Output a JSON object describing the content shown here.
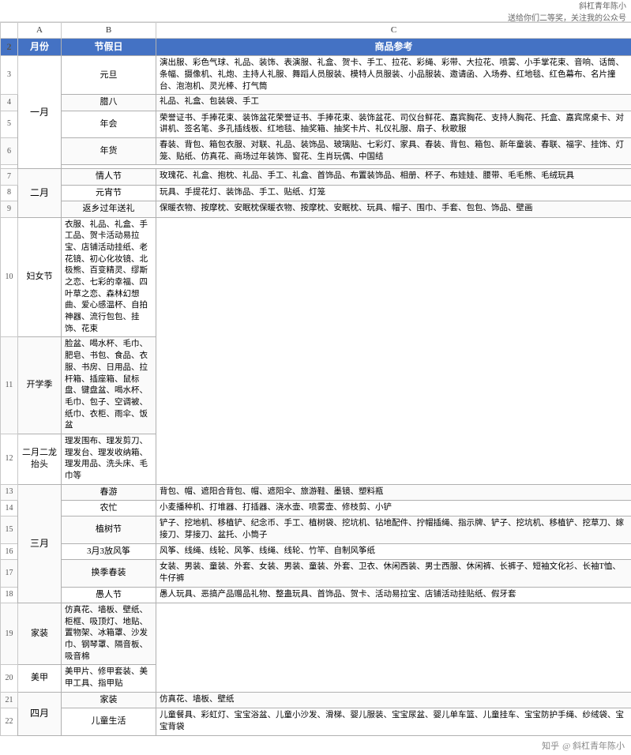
{
  "topBar": {
    "attribution": "斜杠青年陈小",
    "line2": "送给你们二等奖，关注我的公众号"
  },
  "colHeaders": [
    "",
    "A",
    "B",
    "C"
  ],
  "tableHeader": {
    "rowNum": "2",
    "colA": "月份",
    "colB": "节假日",
    "colC": "商品参考"
  },
  "rows": [
    {
      "rowNum": "3",
      "month": "一月",
      "monthSpan": 5,
      "festival": "元旦",
      "products": "演出服、彩色气球、礼品、装饰、表演服、礼盒、贺卡、手工、拉花、彩绳、彩带、大拉花、喷雾、小手掌花束、音响、话筒、条幅、摄像机、礼炮、主持人礼服、舞蹈人员服装、模特人员服装、小品服装、邀请函、入场券、红地毯、红色幕布、名片撞台、泡泡机、灵光棒、打气筒"
    },
    {
      "rowNum": "4",
      "festival": "腊八",
      "products": "礼品、礼盒、包装袋、手工"
    },
    {
      "rowNum": "5",
      "festival": "年会",
      "products": "荣誉证书、手捧花束、装饰盆花荣誉证书、手捧花束、装饰盆花、司仪台鲜花、嘉宾胸花、支持人胸花、托盒、嘉宾席桌卡、对讲机、签名笔、多孔插线板、红地毯、抽奖箱、抽奖卡片、礼仪礼服、扇子、秋歌服"
    },
    {
      "rowNum": "6",
      "festival": "年货",
      "products": "春装、背包、箱包衣服、对联、礼品、装饰品、玻璃贴、七彩灯、家具、春装、背包、箱包、新年童装、春联、福字、挂饰、灯笼、贴纸、仿真花、商场过年装饰、窗花、生肖玩偶、中国结"
    },
    {
      "rowNum": "7",
      "month": "二月",
      "monthSpan": 3,
      "festival": "情人节",
      "products": "玫瑰花、礼盒、抱枕、礼品、手工、礼盒、首饰品、布置装饰品、相册、杯子、布娃娃、腰带、毛毛熊、毛绒玩具"
    },
    {
      "rowNum": "8",
      "festival": "元宵节",
      "products": "玩具、手提花灯、装饰品、手工、贴纸、灯笼"
    },
    {
      "rowNum": "9",
      "festival": "返乡过年送礼",
      "products": "保暖衣物、按摩枕、安眠枕保暖衣物、按摩枕、安眠枕、玩具、帽子、围巾、手套、包包、饰品、壁画"
    },
    {
      "rowNum": "10",
      "festival": "妇女节",
      "products": "衣服、礼品、礼盒、手工品、贺卡活动易拉宝、店铺活动挂纸、老花镜、初心化妆镜、北极熊、百变精灵、缪斯之恋、七彩的幸福、四叶草之恋、森林幻想曲、爱心感温杯、自拍神器、流行包包、挂饰、花束"
    },
    {
      "rowNum": "11",
      "festival": "开学季",
      "products": "脸盆、喝水杯、毛巾、肥皂、书包、食品、衣服、书房、日用品、拉杆箱、插座箱、鼠标盘、键盘盆、喝水杯、毛巾、包子、空调被、纸巾、衣柜、雨伞、饭盆"
    },
    {
      "rowNum": "12",
      "festival": "二月二龙抬头",
      "products": "理发围布、理发剪刀、理发台、理发收纳箱、理发用品、洗头床、毛巾等"
    },
    {
      "rowNum": "13",
      "month": "三月",
      "monthSpan": 6,
      "festival": "春游",
      "products": "背包、帽、遮阳合背包、帽、遮阳伞、旅游鞋、墨镜、塑料瓶"
    },
    {
      "rowNum": "14",
      "festival": "农忙",
      "products": "小麦播种机、打堆器、打插器、浇水壶、喷雾壶、修枝剪、小铲"
    },
    {
      "rowNum": "15",
      "festival": "植树节",
      "products": "铲子、挖地机、移植铲、纪念币、手工、植树袋、挖坑机、钻地配件、拧帽插绳、指示牌、铲子、挖坑机、移植铲、挖草刀、嫁接刀、芽接刀、盆托、小筒子"
    },
    {
      "rowNum": "16",
      "festival": "3月3放风筝",
      "products": "风筝、线绳、线轮、风筝、线绳、线轮、竹竿、自制风筝纸"
    },
    {
      "rowNum": "17",
      "festival": "换季春装",
      "products": "女装、男装、童装、外套、女装、男装、童装、外套、卫衣、休闲西装、男士西服、休闲裤、长裤子、短袖文化衫、长袖T恤、牛仔裤"
    },
    {
      "rowNum": "18",
      "festival": "愚人节",
      "products": "愚人玩具、恶搞产品赠品礼物、整蛊玩具、首饰品、贺卡、活动易拉宝、店铺活动挂贴纸、假牙套"
    },
    {
      "rowNum": "19",
      "festival": "家装",
      "products": "仿真花、墙板、壁纸、柜框、吸顶灯、地贴、置物架、冰箱罩、沙发巾、钢琴罩、隔音板、吸音棉"
    },
    {
      "rowNum": "20",
      "festival": "美甲",
      "products": "美甲片、修甲套装、美甲工具、指甲贴"
    },
    {
      "rowNum": "21",
      "month": "四月",
      "monthSpan": 2,
      "festival": "家装",
      "products": "仿真花、墙板、壁纸"
    },
    {
      "rowNum": "22",
      "festival": "儿童生活",
      "products": "儿童餐具、彩虹灯、宝宝浴盆、儿童小沙发、滑梯、婴儿服装、宝宝尿盆、婴儿单车篮、儿童挂车、宝宝防护手绳、纱绒袋、宝宝背袋"
    }
  ],
  "watermark": {
    "site": "知乎",
    "author": "@ 斜杠青年陈小",
    "note": ""
  }
}
